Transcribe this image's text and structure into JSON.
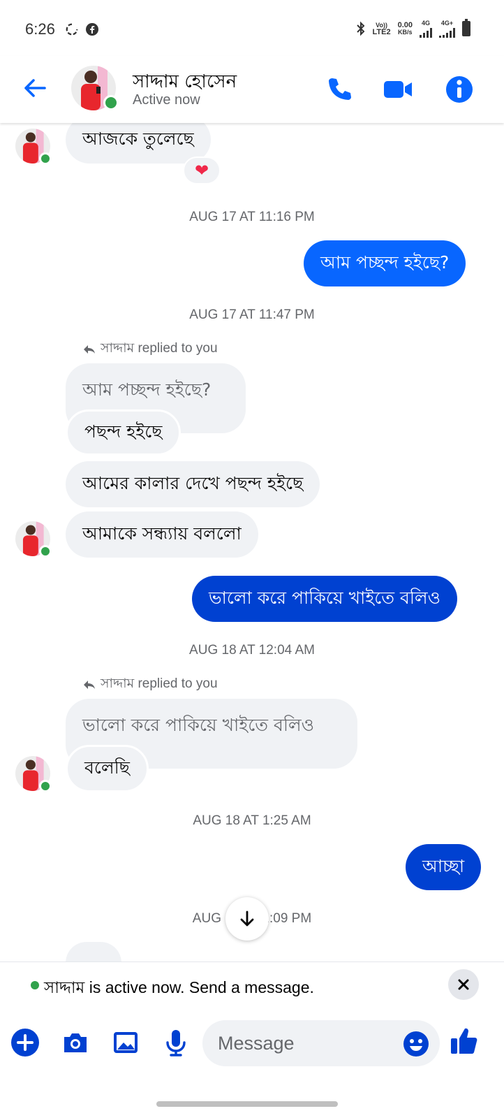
{
  "status_bar": {
    "time": "6:26",
    "net_volte": "Vo))",
    "net_lte2": "LTE2",
    "speed_value": "0.00",
    "speed_unit": "KB/s",
    "sim1_type": "4G",
    "sim2_type": "4G+"
  },
  "header": {
    "contact_name": "সাদ্দাম হোসেন",
    "presence": "Active now",
    "icons": [
      "back-arrow-icon",
      "phone-icon",
      "video-camera-icon",
      "info-icon"
    ]
  },
  "messages": [
    {
      "dir": "in",
      "text": "আজকে তুলেছে",
      "reaction": "❤"
    },
    {
      "ts": "AUG 17 AT 11:16 PM"
    },
    {
      "dir": "out",
      "text": "আম পচ্ছন্দ হইছে?"
    },
    {
      "ts": "AUG 17 AT 11:47 PM"
    },
    {
      "reply_note": "সাদ্দাম replied to you"
    },
    {
      "dir": "quote",
      "text": "আম পচ্ছন্দ হইছে?"
    },
    {
      "dir": "in",
      "text": "পছন্দ হইছে"
    },
    {
      "dir": "in",
      "text": "আমের কালার দেখে পছন্দ হইছে"
    },
    {
      "dir": "in",
      "text": "আমাকে সন্ধ্যায় বললো"
    },
    {
      "dir": "out",
      "text": "ভালো করে পাকিয়ে খাইতে বলিও"
    },
    {
      "ts": "AUG 18 AT 12:04 AM"
    },
    {
      "reply_note": "সাদ্দাম replied to you"
    },
    {
      "dir": "quote",
      "text": "ভালো করে পাকিয়ে খাইতে বলিও"
    },
    {
      "dir": "in",
      "text": "বলেছি"
    },
    {
      "ts": "AUG 18 AT 1:25 AM"
    },
    {
      "dir": "out",
      "text": "আচ্ছা"
    },
    {
      "ts": "AUG 18 AT 1:09 PM"
    }
  ],
  "banner": {
    "text": "সাদ্দাম is active now. Send a message."
  },
  "composer": {
    "placeholder": "Message",
    "icons": [
      "plus-icon",
      "camera-icon",
      "gallery-icon",
      "microphone-icon",
      "emoji-icon",
      "thumbs-up-icon"
    ]
  },
  "colors": {
    "accent": "#0866ff",
    "dark_outgoing": "#0041d1",
    "incoming_bubble": "#f0f2f5",
    "online": "#31a24c"
  }
}
